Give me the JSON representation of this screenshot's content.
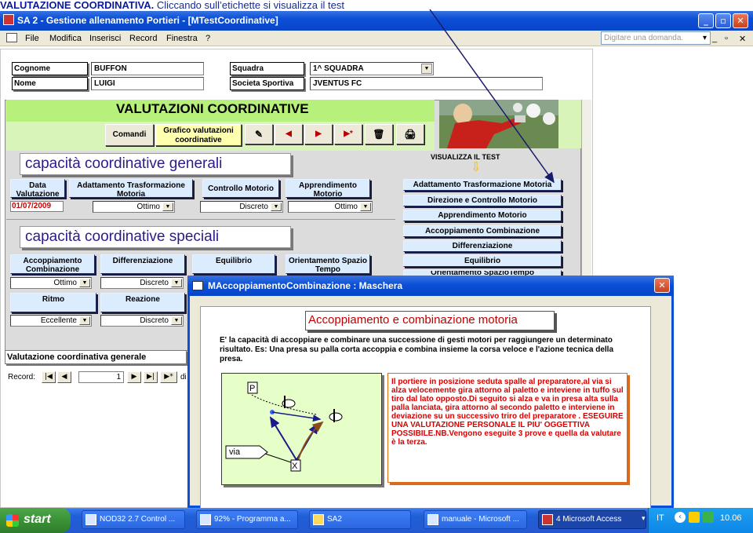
{
  "caption": {
    "bold": "VALUTAZIONE COORDINATIVA.",
    "rest": " Cliccando sull’etichette si visualizza il test"
  },
  "window": {
    "title": "SA 2 - Gestione allenamento Portieri - [MTestCoordinative]",
    "controls": [
      "_",
      "▫",
      "✕"
    ]
  },
  "menu": {
    "items": [
      "File",
      "Modifica",
      "Inserisci",
      "Record",
      "Finestra",
      "?"
    ],
    "ask_placeholder": "Digitare una domanda.",
    "doc_controls": [
      "_",
      "▫",
      "✕"
    ]
  },
  "player": {
    "cognome_label": "Cognome",
    "cognome": "BUFFON",
    "nome_label": "Nome",
    "nome": "LUIGI",
    "squadra_label": "Squadra",
    "squadra": "1^ SQUADRA",
    "societa_label": "Societa Sportiva",
    "societa": "JVENTUS FC"
  },
  "subform": {
    "title": "VALUTAZIONI COORDINATIVE",
    "comandi": "Comandi",
    "grafico": "Grafico valutazioni coordinative",
    "nav_icons": [
      "✎",
      "◀",
      "▶",
      "▶*",
      "🗑",
      "🖨"
    ],
    "generali": "capacità coordinative generali",
    "speciali": "capacità coordinative speciali",
    "data_label": "Data Valutazione",
    "data_value": "01/07/2009",
    "gen_headers": [
      "Adattamento Trasformazione Motoria",
      "Controllo Motorio",
      "Apprendimento Motorio"
    ],
    "gen_values": [
      "Ottimo",
      "Discreto",
      "Ottimo"
    ],
    "spec_headers_row1": [
      "Accoppiamento Combinazione",
      "Differenziazione",
      "Equilibrio",
      "Orientamento Spazio Tempo"
    ],
    "spec_values_row1": [
      "Ottimo",
      "Discreto"
    ],
    "spec_headers_row2": [
      "Ritmo",
      "Reazione"
    ],
    "spec_values_row2": [
      "Eccellente",
      "Discreto"
    ],
    "visualizza": "VISUALIZZA IL TEST",
    "tests": [
      "Adattamento Trasformazione Motoria",
      "Direzione e Controllo Motorio",
      "Apprendimento Motorio",
      "Accoppiamento Combinazione",
      "Differenziazione",
      "Equilibrio",
      "Orientamento SpazioTempo"
    ]
  },
  "generale": "Valutazione coordinativa generale",
  "record": {
    "label": "Record:",
    "value": "1",
    "of": "di"
  },
  "modal": {
    "title": "MAccoppiamentoCombinazione : Maschera",
    "heading": "Accoppiamento e combinazione motoria",
    "description": "E' la capacità di accoppiare e combinare una successione di gesti motori per raggiungere un determinato risultato. Es: Una presa su palla corta accoppia e combina insieme la corsa veloce e l'azione tecnica della presa.",
    "diagram_p": "P",
    "diagram_x": "X",
    "diagram_via": "via",
    "instructions": "Il portiere  in posizione seduta spalle al preparatore,al via si alza velocemente gira attorno al paletto e inteviene in tuffo sul tiro dal lato opposto.Di seguito si alza e va in presa alta sulla palla lanciata, gira attorno al secondo paletto e interviene in deviazione su un successivo triro del preparatore . ESEGUIRE UNA VALUTAZIONE PERSONALE IL PIU' OGGETTIVA POSSIBILE.NB.Vengono eseguite 3 prove e quella da valutare è la terza."
  },
  "taskbar": {
    "start": "start",
    "tasks": [
      "NOD32 2.7 Control ...",
      "92% - Programma a...",
      "SA2",
      "manuale - Microsoft ...",
      "4 Microsoft Access"
    ],
    "lang": "IT",
    "clock": "10.06"
  }
}
